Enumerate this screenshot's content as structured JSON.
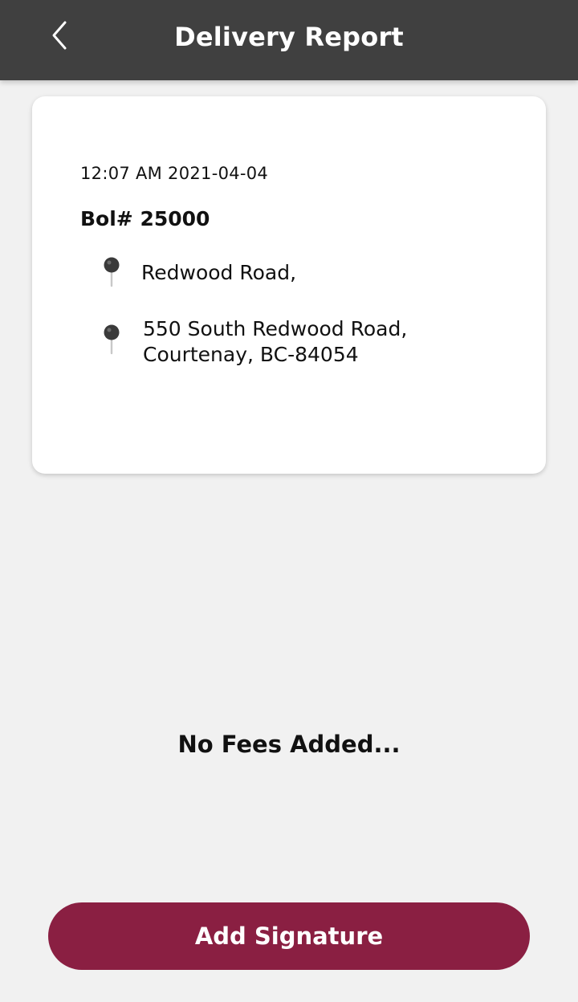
{
  "header": {
    "title": "Delivery Report",
    "back_icon": "chevron-left-icon"
  },
  "delivery": {
    "timestamp": "12:07 AM 2021-04-04",
    "bol": "Bol# 25000",
    "pickup_address": "Redwood Road,",
    "drop_address": "550 South Redwood Road,\nCourtenay, BC-84054",
    "pin_icon": "map-pin-icon"
  },
  "fees": {
    "empty_message": "No Fees Added..."
  },
  "actions": {
    "add_signature_label": "Add Signature"
  },
  "colors": {
    "header_bg": "#404040",
    "page_bg": "#f1f1f1",
    "primary_button": "#8a1f42"
  }
}
